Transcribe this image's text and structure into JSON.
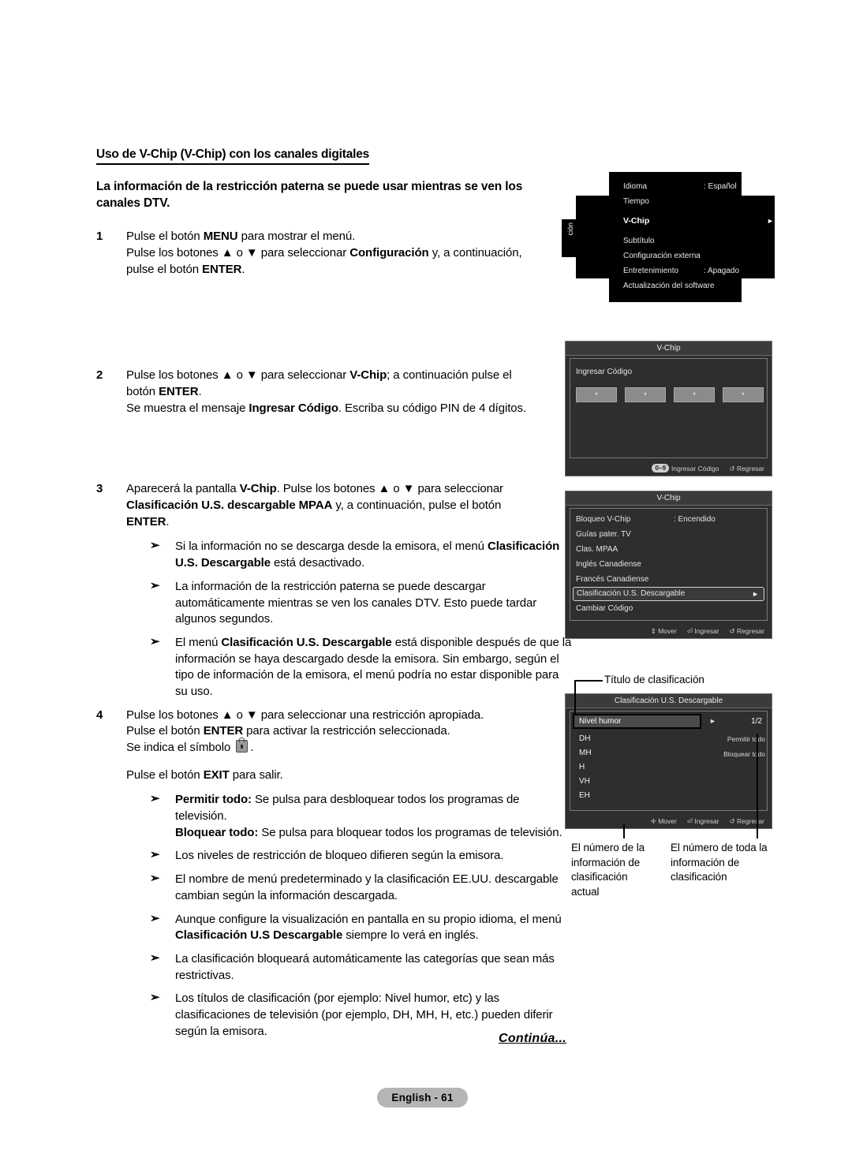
{
  "document": {
    "heading": "Uso de V-Chip (V-Chip) con los canales digitales",
    "subheading": "La información de la restricción paterna se puede usar mientras se ven los canales DTV.",
    "continued_label": "Continúa...",
    "page_badge": "English - 61"
  },
  "steps": [
    {
      "number": "1",
      "lines": [
        "Pulse el botón MENU para mostrar el menú.",
        "Pulse los botones ▲ o ▼ para seleccionar Configuración y, a continuación, pulse el botón ENTER."
      ]
    },
    {
      "number": "2",
      "lines": [
        "Pulse los botones ▲ o ▼ para seleccionar V-Chip; a continuación pulse el botón ENTER.",
        "Se muestra el mensaje Ingresar Código. Escriba su código PIN de 4 dígitos."
      ]
    },
    {
      "number": "3",
      "lines": [
        "Aparecerá la pantalla V-Chip. Pulse los botones ▲ o ▼ para seleccionar Clasificación U.S. descargable MPAA y, a continuación, pulse el botón ENTER."
      ],
      "bullets": [
        "Si la información no se descarga desde la emisora, el menú Clasificación U.S. Descargable está desactivado.",
        "La información de la restricción paterna se puede descargar automáticamente mientras se ven los canales DTV. Esto puede tardar algunos segundos.",
        "El menú Clasificación U.S. Descargable está disponible después de que la información se haya descargado desde la emisora. Sin embargo, según el tipo de información de la emisora, el menú podría no estar disponible para su uso."
      ]
    },
    {
      "number": "4",
      "lines": [
        "Pulse los botones ▲ o ▼ para seleccionar una restricción apropiada.",
        "Pulse el botón ENTER para activar la restricción seleccionada.",
        "Se indica el símbolo 🔒 .",
        "Pulse el botón EXIT para salir."
      ],
      "bullets": [
        "Permitir todo: Se pulsa para desbloquear todos los programas de televisión. Bloquear todo: Se pulsa para bloquear todos los programas de televisión.",
        "Los niveles de restricción de bloqueo difieren según la emisora.",
        "El nombre de menú predeterminado y la clasificación EE.UU. descargable cambian según la información descargada.",
        "Aunque configure la visualización en pantalla en su propio idioma, el menú Clasificación U.S Descargable siempre lo verá en inglés.",
        "La clasificación bloqueará automáticamente las categorías que sean más restrictivas.",
        "Los títulos de clasificación (por ejemplo: Nivel humor, etc) y las clasificaciones de televisión (por ejemplo, DH, MH, H, etc.) pueden diferir según la emisora."
      ]
    }
  ],
  "osd_setup_menu": {
    "tab_label": "ción",
    "rows": [
      {
        "label": "Idioma",
        "value": ": Español",
        "selected": false,
        "arrow": ""
      },
      {
        "label": "Tiempo",
        "value": "",
        "selected": false,
        "arrow": ""
      },
      {
        "label": "V-Chip",
        "value": "",
        "selected": true,
        "arrow": "►"
      },
      {
        "label": "Subtítulo",
        "value": "",
        "selected": false,
        "arrow": ""
      },
      {
        "label": "Configuración externa",
        "value": "",
        "selected": false,
        "arrow": ""
      },
      {
        "label": "Entretenimiento",
        "value": ": Apagado",
        "selected": false,
        "arrow": ""
      },
      {
        "label": "Actualización del software",
        "value": "",
        "selected": false,
        "arrow": ""
      }
    ]
  },
  "osd_pin_dialog": {
    "title": "V-Chip",
    "prompt": "Ingresar Código",
    "pin_digits": [
      "*",
      "*",
      "*",
      "*"
    ],
    "footer": {
      "key_hint_pill": "0~9",
      "key_hint_label": "Ingresar Código",
      "back_icon": "↺",
      "back_label": "Regresar"
    }
  },
  "osd_vchip_menu": {
    "title": "V-Chip",
    "items": [
      {
        "label": "Bloqueo V-Chip",
        "value": ": Encendido",
        "highlighted": false,
        "arrow": ""
      },
      {
        "label": "Guías pater. TV",
        "value": "",
        "highlighted": false,
        "arrow": ""
      },
      {
        "label": "Clas. MPAA",
        "value": "",
        "highlighted": false,
        "arrow": ""
      },
      {
        "label": "Inglés Canadiense",
        "value": "",
        "highlighted": false,
        "arrow": ""
      },
      {
        "label": "Francés Canadiense",
        "value": "",
        "highlighted": false,
        "arrow": ""
      },
      {
        "label": "Clasificación U.S. Descargable",
        "value": "",
        "highlighted": true,
        "arrow": "►"
      },
      {
        "label": "Cambiar Código",
        "value": "",
        "highlighted": false,
        "arrow": ""
      }
    ],
    "footer": {
      "move_icon": "⇕",
      "move_label": "Mover",
      "enter_icon": "⏎",
      "enter_label": "Ingresar",
      "back_icon": "↺",
      "back_label": "Regresar"
    }
  },
  "osd_downloadable_menu": {
    "title": "Clasificación U.S. Descargable",
    "selected_row": "Nivel humor",
    "selected_arrow": "►",
    "page_indicator": "1/2",
    "codes": [
      "DH",
      "MH",
      "H",
      "VH",
      "EH"
    ],
    "actions": [
      "Permitir todo",
      "Bloquear todo"
    ],
    "footer": {
      "move_icon": "✛",
      "move_label": "Mover",
      "enter_icon": "⏎",
      "enter_label": "Ingresar",
      "back_icon": "↺",
      "back_label": "Regresar"
    }
  },
  "callouts": {
    "title": "Título de clasificación",
    "left": "El número de la información de clasificación actual",
    "right": "El número de toda la información de clasificación"
  }
}
